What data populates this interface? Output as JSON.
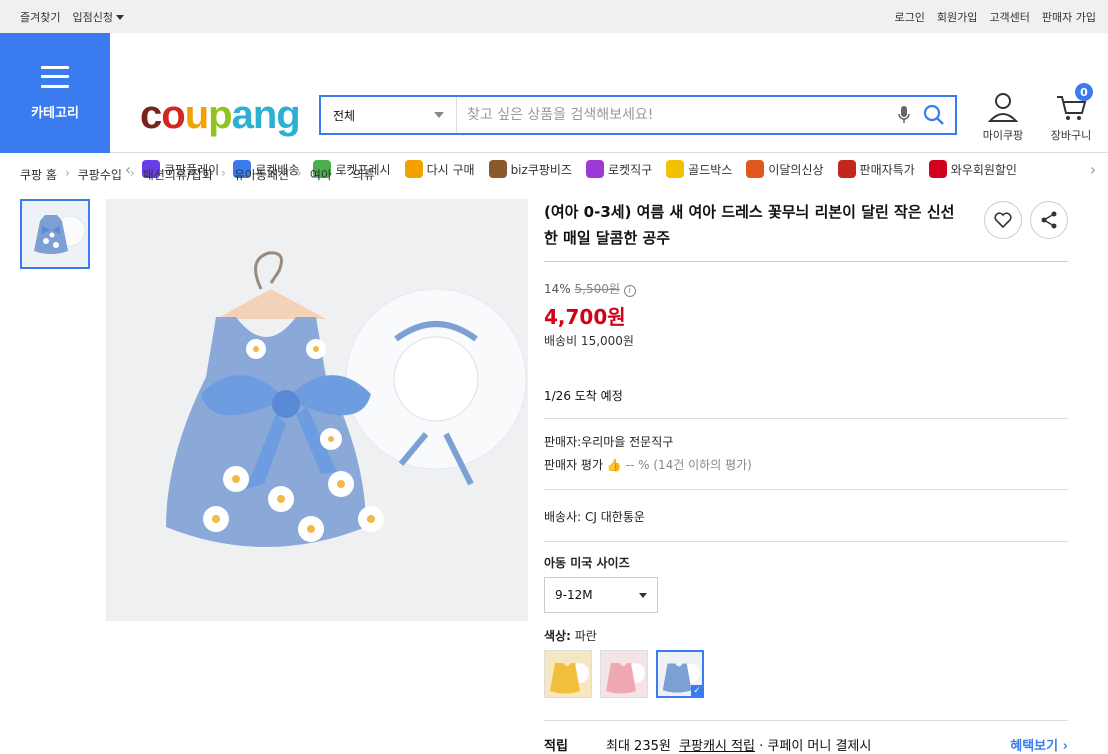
{
  "topbar": {
    "left": [
      "즐겨찾기",
      "입점신청"
    ],
    "right": [
      "로그인",
      "회원가입",
      "고객센터",
      "판매자 가입"
    ]
  },
  "category": {
    "label": "카테고리"
  },
  "logo": {
    "text": "coupang"
  },
  "search": {
    "scope": "전체",
    "placeholder": "찾고 싶은 상품을 검색해보세요!"
  },
  "account": {
    "label": "마이쿠팡"
  },
  "cart": {
    "label": "장바구니",
    "count": "0"
  },
  "quicknav": [
    {
      "label": "쿠팡플레이",
      "color": "#6b3de8"
    },
    {
      "label": "로켓배송",
      "color": "#3a7bf0"
    },
    {
      "label": "로켓프레시",
      "color": "#4cae4c"
    },
    {
      "label": "다시 구매",
      "color": "#f2a100"
    },
    {
      "label": "biz쿠팡비즈",
      "color": "#8a5a2b"
    },
    {
      "label": "로켓직구",
      "color": "#9b3ad6"
    },
    {
      "label": "골드박스",
      "color": "#f2c200"
    },
    {
      "label": "이달의신상",
      "color": "#e2561f"
    },
    {
      "label": "판매자특가",
      "color": "#c0281e"
    },
    {
      "label": "와우회원할인",
      "color": "#d0021b"
    }
  ],
  "breadcrumbs": [
    "쿠팡 홈",
    "쿠팡수입",
    "패션의류/잡화",
    "유아동패션",
    "여아",
    "의류"
  ],
  "product": {
    "title": "(여아 0-3세) 여름 새 여아 드레스 꽃무늬 리본이 달린 작은 신선한 매일 달콤한 공주",
    "discount": "14%",
    "original_price": "5,500원",
    "price": "4,700원",
    "shipping": "배송비 15,000원",
    "arrival": "1/26 도착 예정",
    "seller": "판매자:우리마을 전문직구",
    "seller_rating_label": "판매자 평가",
    "seller_rating_value": "-- % (14건 이하의 평가)",
    "courier_label": "배송사:",
    "courier": "CJ 대한통운",
    "size_label": "아동 미국 사이즈",
    "size_value": "9-12M",
    "color_label": "색상:",
    "color_value": "파란",
    "reward_label": "적립",
    "reward_text": "최대 235원",
    "reward_link": "쿠팡캐시 적립",
    "reward_tail": "· 쿠페이 머니 결제시",
    "reward_more": "혜택보기"
  },
  "colors": {
    "accent": "#3a7bf0",
    "price": "#d0021b"
  }
}
